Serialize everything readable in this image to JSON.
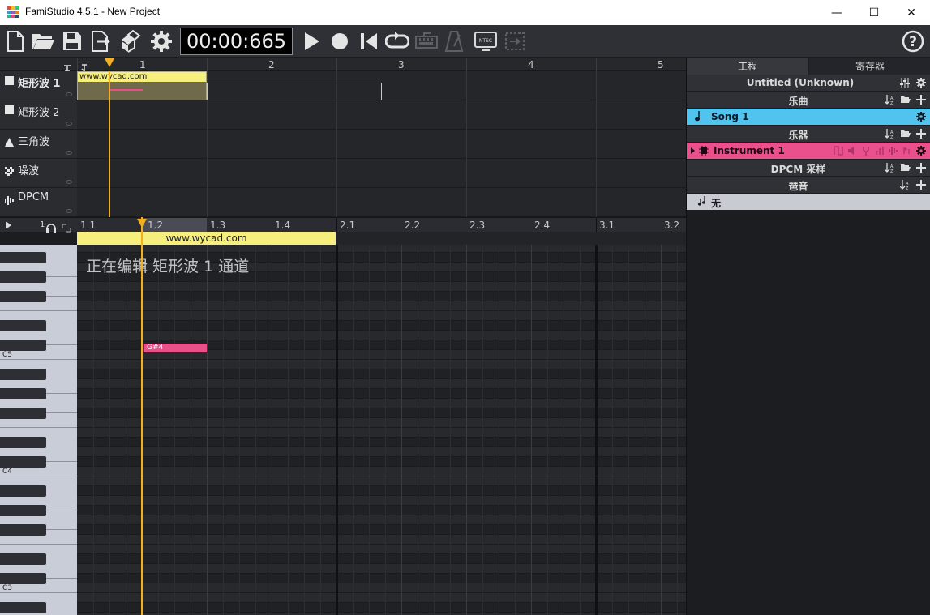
{
  "window": {
    "title": "FamiStudio 4.5.1 - New Project",
    "minimize": "—",
    "maximize": "☐",
    "close": "✕"
  },
  "toolbar": {
    "icons": [
      "new-file-icon",
      "open-folder-icon",
      "save-icon",
      "export-icon",
      "copy-paste-icon",
      "settings-gear-icon"
    ],
    "timecode": "00:00:665",
    "transport": [
      "play-icon",
      "record-icon",
      "rewind-icon",
      "loop-icon",
      "piano-keyboard-icon",
      "metronome-icon",
      "ntsc-icon",
      "jump-icon"
    ],
    "ntsc_label": "NTSC",
    "help": "?"
  },
  "sequencer": {
    "bar_numbers": [
      "1",
      "2",
      "3",
      "4",
      "5"
    ],
    "channels": [
      {
        "name": "矩形波 1",
        "icon": "square-wave-icon",
        "active": true
      },
      {
        "name": "矩形波 2",
        "icon": "square-wave-icon",
        "active": false
      },
      {
        "name": "三角波",
        "icon": "triangle-wave-icon",
        "active": false
      },
      {
        "name": "噪波",
        "icon": "noise-icon",
        "active": false
      },
      {
        "name": "DPCM",
        "icon": "dpcm-icon",
        "active": false
      }
    ],
    "pattern_label": "www.wycad.com"
  },
  "piano_roll": {
    "beats": [
      "1.1",
      "1.2",
      "1.3",
      "1.4",
      "2.1",
      "2.2",
      "2.3",
      "2.4",
      "3.1",
      "3.2"
    ],
    "zoom_label": "1",
    "pattern_label": "www.wycad.com",
    "editing_label": "正在编辑 矩形波 1 通道",
    "octave_labels": [
      "C5",
      "C4",
      "C3"
    ],
    "note": {
      "name": "G#4"
    }
  },
  "project_panel": {
    "tabs": [
      "工程",
      "寄存器"
    ],
    "project_title": "Untitled (Unknown)",
    "songs_header": "乐曲",
    "song": "Song 1",
    "instruments_header": "乐器",
    "instrument": "Instrument 1",
    "dpcm_header": "DPCM 采样",
    "arpeggio_header": "琶音",
    "arpeggio_none": "无"
  },
  "colors": {
    "song": "#51c3ef",
    "instrument": "#e9508c",
    "pattern": "#f6ee7d",
    "playhead": "#f2b01e",
    "note": "#e8508a"
  }
}
